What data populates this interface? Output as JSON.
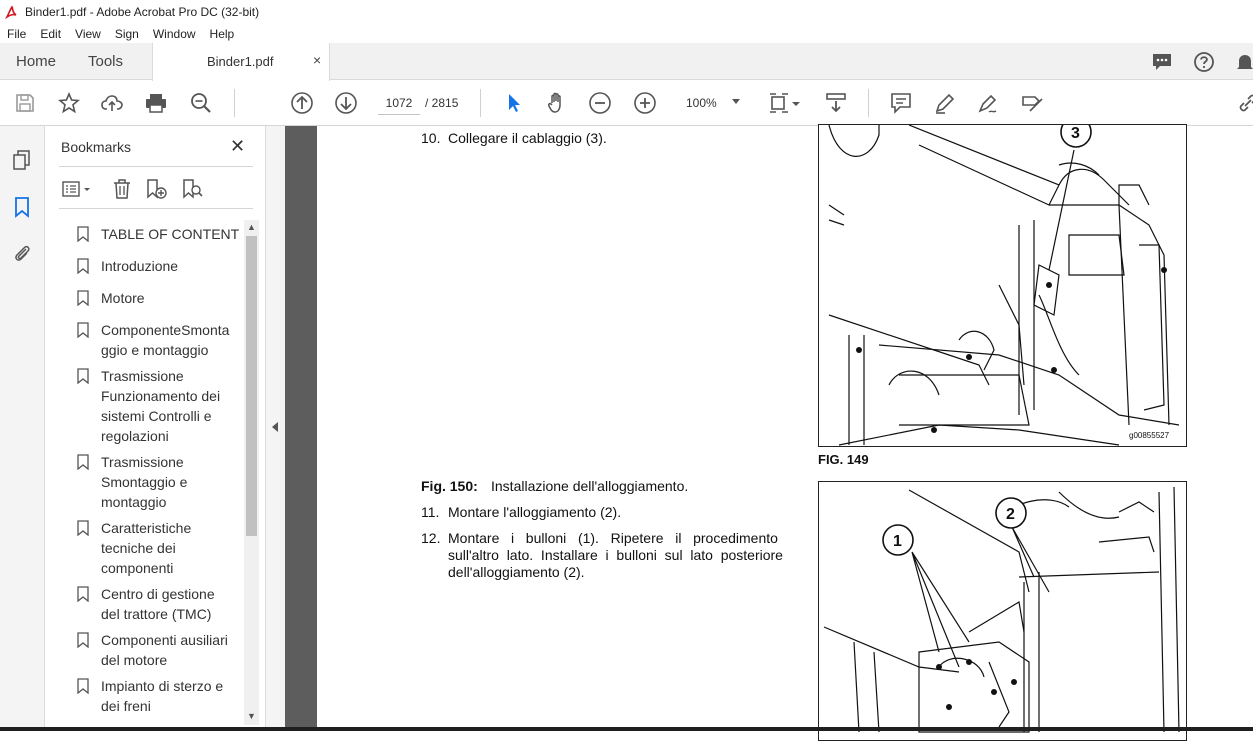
{
  "window": {
    "title": "Binder1.pdf - Adobe Acrobat Pro DC (32-bit)"
  },
  "menu": [
    "File",
    "Edit",
    "View",
    "Sign",
    "Window",
    "Help"
  ],
  "tabs": {
    "home": "Home",
    "tools": "Tools",
    "document": "Binder1.pdf",
    "close_glyph": "×"
  },
  "toolbar": {
    "page_current": "1072",
    "page_total": "/  2815",
    "zoom": "100%"
  },
  "bookmarks": {
    "title": "Bookmarks",
    "close_glyph": "✕",
    "items": [
      "TABLE OF CONTENT",
      "Introduzione",
      "Motore",
      "ComponenteSmonta\nggio e montaggio",
      "Trasmissione\nFunzionamento dei\nsistemi Controlli e\nregolazioni",
      "Trasmissione\nSmontaggio e\nmontaggio",
      "Caratteristiche\ntecniche dei\ncomponenti",
      "Centro di gestione\ndel trattore (TMC)",
      "Componenti ausiliari\ndel motore",
      "Impianto di sterzo e\ndei freni"
    ]
  },
  "document": {
    "step10_num": "10.",
    "step10_text": "Collegare il cablaggio (3).",
    "fig150_caption_bold": "Fig. 150:",
    "fig150_caption_text": "Installazione dell'alloggiamento.",
    "step11_num": "11.",
    "step11_text": "Montare l'alloggiamento (2).",
    "step12_num": "12.",
    "step12_line1": "Montare   i   bulloni   (1).   Ripetere   il   procedimento",
    "step12_line2": "sull'altro  lato.  Installare  i  bulloni  sul  lato  posteriore",
    "step12_line3": "dell'alloggiamento (2).",
    "fig149_label": "FIG. 149",
    "fig149_code": "g00855527",
    "callout_3": "3",
    "callout_1": "1",
    "callout_2": "2"
  },
  "icons": {
    "rail": [
      "pages-icon",
      "bookmark-icon",
      "attachment-icon"
    ],
    "accent": "#1473e6"
  }
}
